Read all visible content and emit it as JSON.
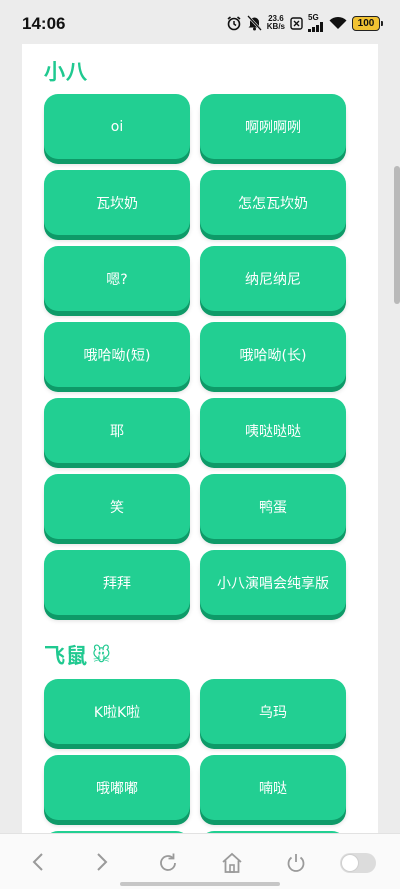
{
  "status_bar": {
    "time": "14:06",
    "net_speed_value": "23.6",
    "net_speed_unit": "KB/s",
    "net_type": "5G",
    "battery": "100",
    "icons": [
      "alarm-icon",
      "mute-bell-icon",
      "close-box-icon",
      "signal-icon",
      "wifi-icon",
      "battery-icon"
    ]
  },
  "sections": [
    {
      "title": "小八",
      "emoji": "",
      "buttons": [
        "oi",
        "啊咧啊咧",
        "瓦坎奶",
        "怎怎瓦坎奶",
        "嗯?",
        "纳尼纳尼",
        "哦哈呦(短)",
        "哦哈呦(长)",
        "耶",
        "咦哒哒哒",
        "笑",
        "鸭蛋",
        "拜拜",
        "小八演唱会纯享版"
      ]
    },
    {
      "title": "飞鼠",
      "emoji": "🐭",
      "buttons": [
        "K啦K啦",
        "乌玛",
        "哦嘟嘟",
        "喃哒",
        "",
        ""
      ]
    }
  ],
  "bottom_bar": {
    "icons": [
      "back-icon",
      "forward-icon",
      "refresh-icon",
      "home-icon",
      "power-icon",
      "toggle-switch"
    ]
  },
  "colors": {
    "accent": "#22cf92",
    "accent_shadow": "#0e9a68",
    "title": "#20c990",
    "page_bg": "#ececec"
  }
}
